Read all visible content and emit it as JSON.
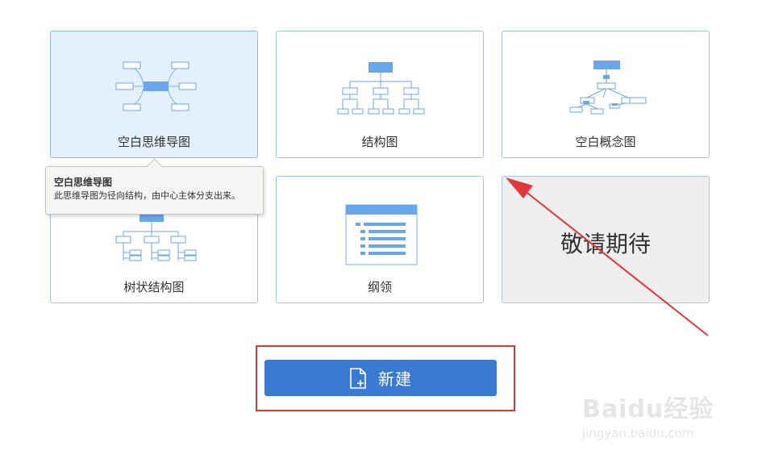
{
  "templates": [
    {
      "label": "空白思维导图",
      "state": "selected",
      "icon": "mindmap-icon"
    },
    {
      "label": "结构图",
      "state": "normal",
      "icon": "org-chart-icon"
    },
    {
      "label": "空白概念图",
      "state": "normal",
      "icon": "concept-map-icon"
    },
    {
      "label": "树状结构图",
      "state": "normal",
      "icon": "tree-chart-icon"
    },
    {
      "label": "纲领",
      "state": "normal",
      "icon": "outline-icon"
    },
    {
      "label": "敬请期待",
      "state": "coming-soon"
    }
  ],
  "tooltip": {
    "title": "空白思维导图",
    "description": "此思维导图为径向结构，由中心主体分支出来。"
  },
  "new_button": {
    "label": "新建",
    "icon": "new-file-icon"
  },
  "watermark": {
    "main": "Baidu经验",
    "sub": "jingyan.baidu.com"
  },
  "colors": {
    "accent": "#3a7ad3",
    "card_border": "#9dc3ea",
    "selected_bg": "#e5f0fd",
    "icon_blue": "#6aa6ec",
    "annotation_red": "#e0373a"
  }
}
